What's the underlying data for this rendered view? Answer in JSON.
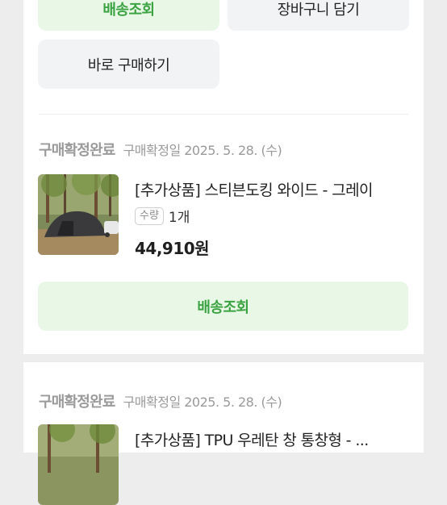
{
  "orders": [
    {
      "buttons": {
        "track_label": "배송조회",
        "cart_label": "장바구니 담기",
        "buy_now_label": "바로 구매하기"
      }
    },
    {
      "status": "구매확정완료",
      "confirm_date": "구매확정일 2025. 5. 28. (수)",
      "product_name": "[추가상품] 스티븐도킹 와이드 - 그레이",
      "qty_label": "수량",
      "qty_value": "1개",
      "price": "44,910원",
      "track_label": "배송조회"
    },
    {
      "status": "구매확정완료",
      "confirm_date": "구매확정일 2025. 5. 28. (수)",
      "product_name": "[추가상품] TPU 우레탄 창 통창형 - ..."
    }
  ],
  "colors": {
    "accent_green": "#3ca343",
    "green_button_bg": "#e8f7e6",
    "gray_button_bg": "#f2f3f5",
    "muted_text": "#9a9a9a"
  }
}
